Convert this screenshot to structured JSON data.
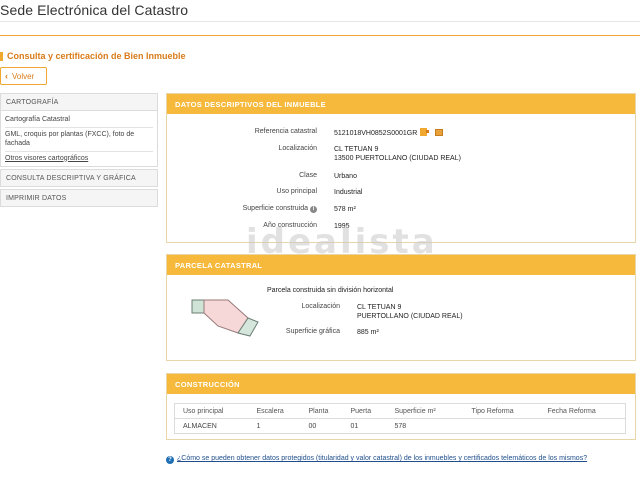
{
  "header": {
    "site_title": "Sede Electrónica del Catastro"
  },
  "page": {
    "heading": "Consulta y certificación de Bien Inmueble",
    "back_label": "Volver"
  },
  "sidebar": {
    "cartografia_title": "CARTOGRAFÍA",
    "items": [
      "Cartografía Catastral",
      "GML, croquis por plantas (FXCC), foto de fachada",
      "Otros visores cartográficos"
    ],
    "consulta_label": "CONSULTA DESCRIPTIVA Y GRÁFICA",
    "imprimir_label": "IMPRIMIR DATOS"
  },
  "datos": {
    "title": "DATOS DESCRIPTIVOS DEL INMUEBLE",
    "ref_label": "Referencia catastral",
    "ref_value": "5121018VH0852S0001GR",
    "loc_label": "Localización",
    "loc_line1": "CL TETUAN 9",
    "loc_line2": "13500 PUERTOLLANO (CIUDAD REAL)",
    "clase_label": "Clase",
    "clase_value": "Urbano",
    "uso_label": "Uso principal",
    "uso_value": "Industrial",
    "sup_label": "Superficie construida",
    "sup_value": "578 m²",
    "anio_label": "Año construcción",
    "anio_value": "1995"
  },
  "watermark": "idealista",
  "parcela": {
    "title": "PARCELA CATASTRAL",
    "note": "Parcela construida sin división horizontal",
    "loc_label": "Localización",
    "loc_line1": "CL TETUAN 9",
    "loc_line2": "PUERTOLLANO (CIUDAD REAL)",
    "sup_label": "Superficie gráfica",
    "sup_value": "885 m²"
  },
  "construccion": {
    "title": "CONSTRUCCIÓN",
    "headers": [
      "Uso principal",
      "Escalera",
      "Planta",
      "Puerta",
      "Superficie m²",
      "Tipo Reforma",
      "Fecha Reforma"
    ],
    "rows": [
      [
        "ALMACEN",
        "1",
        "00",
        "01",
        "578",
        "",
        ""
      ]
    ]
  },
  "footer": {
    "help_link": "¿Cómo se pueden obtener datos protegidos (titularidad y valor catastral) de los inmuebles y certificados telemáticos de los mismos?"
  },
  "colors": {
    "accent": "#f6b93b",
    "accent_dark": "#d97b1a",
    "link": "#1f4e8c"
  }
}
